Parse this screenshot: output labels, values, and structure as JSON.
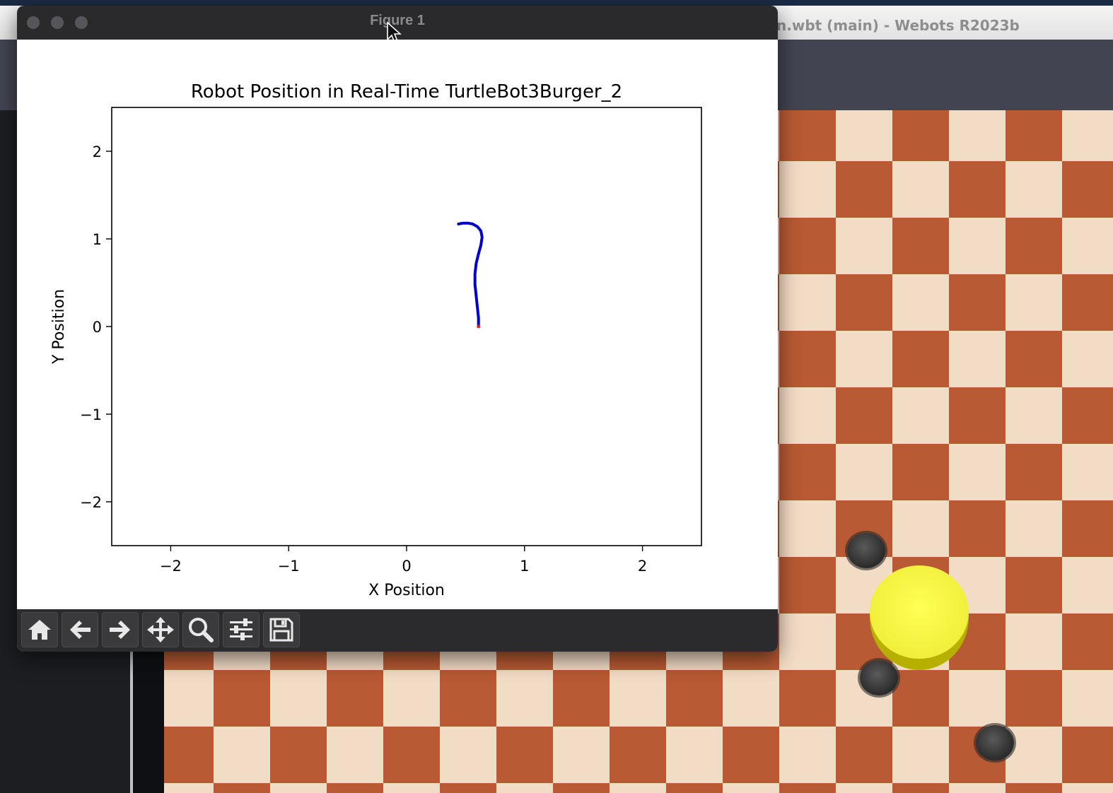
{
  "webots": {
    "window_title": "n.wbt (main) - Webots R2023b"
  },
  "figure_window": {
    "title": "Figure 1",
    "toolbar": {
      "buttons": [
        {
          "icon": "home-icon",
          "tooltip": "Home"
        },
        {
          "icon": "back-arrow-icon",
          "tooltip": "Back"
        },
        {
          "icon": "forward-arrow-icon",
          "tooltip": "Forward"
        },
        {
          "icon": "pan-icon",
          "tooltip": "Pan"
        },
        {
          "icon": "zoom-icon",
          "tooltip": "Zoom"
        },
        {
          "icon": "configure-subplots-icon",
          "tooltip": "Configure subplots"
        },
        {
          "icon": "save-icon",
          "tooltip": "Save"
        }
      ]
    }
  },
  "chart_data": {
    "type": "line",
    "title": "Robot Position in Real-Time TurtleBot3Burger_2",
    "xlabel": "X Position",
    "ylabel": "Y Position",
    "xlim": [
      -2.5,
      2.5
    ],
    "ylim": [
      -2.5,
      2.5
    ],
    "xticks": [
      -2,
      -1,
      0,
      1,
      2
    ],
    "yticks": [
      -2,
      -1,
      0,
      1,
      2
    ],
    "xtick_labels": [
      "−2",
      "−1",
      "0",
      "1",
      "2"
    ],
    "ytick_labels": [
      "−2",
      "−1",
      "0",
      "1",
      "2"
    ],
    "grid": false,
    "series": [
      {
        "color": "#0000cc",
        "x": [
          0.61,
          0.61,
          0.6,
          0.59,
          0.58,
          0.58,
          0.59,
          0.61,
          0.63,
          0.64,
          0.63,
          0.6,
          0.56,
          0.52,
          0.48,
          0.44
        ],
        "y": [
          0.0,
          0.1,
          0.22,
          0.35,
          0.48,
          0.6,
          0.72,
          0.83,
          0.93,
          1.02,
          1.09,
          1.14,
          1.17,
          1.18,
          1.18,
          1.17
        ]
      }
    ],
    "current_position": {
      "x": 0.61,
      "y": 0.0,
      "color": "#dd2222"
    }
  }
}
